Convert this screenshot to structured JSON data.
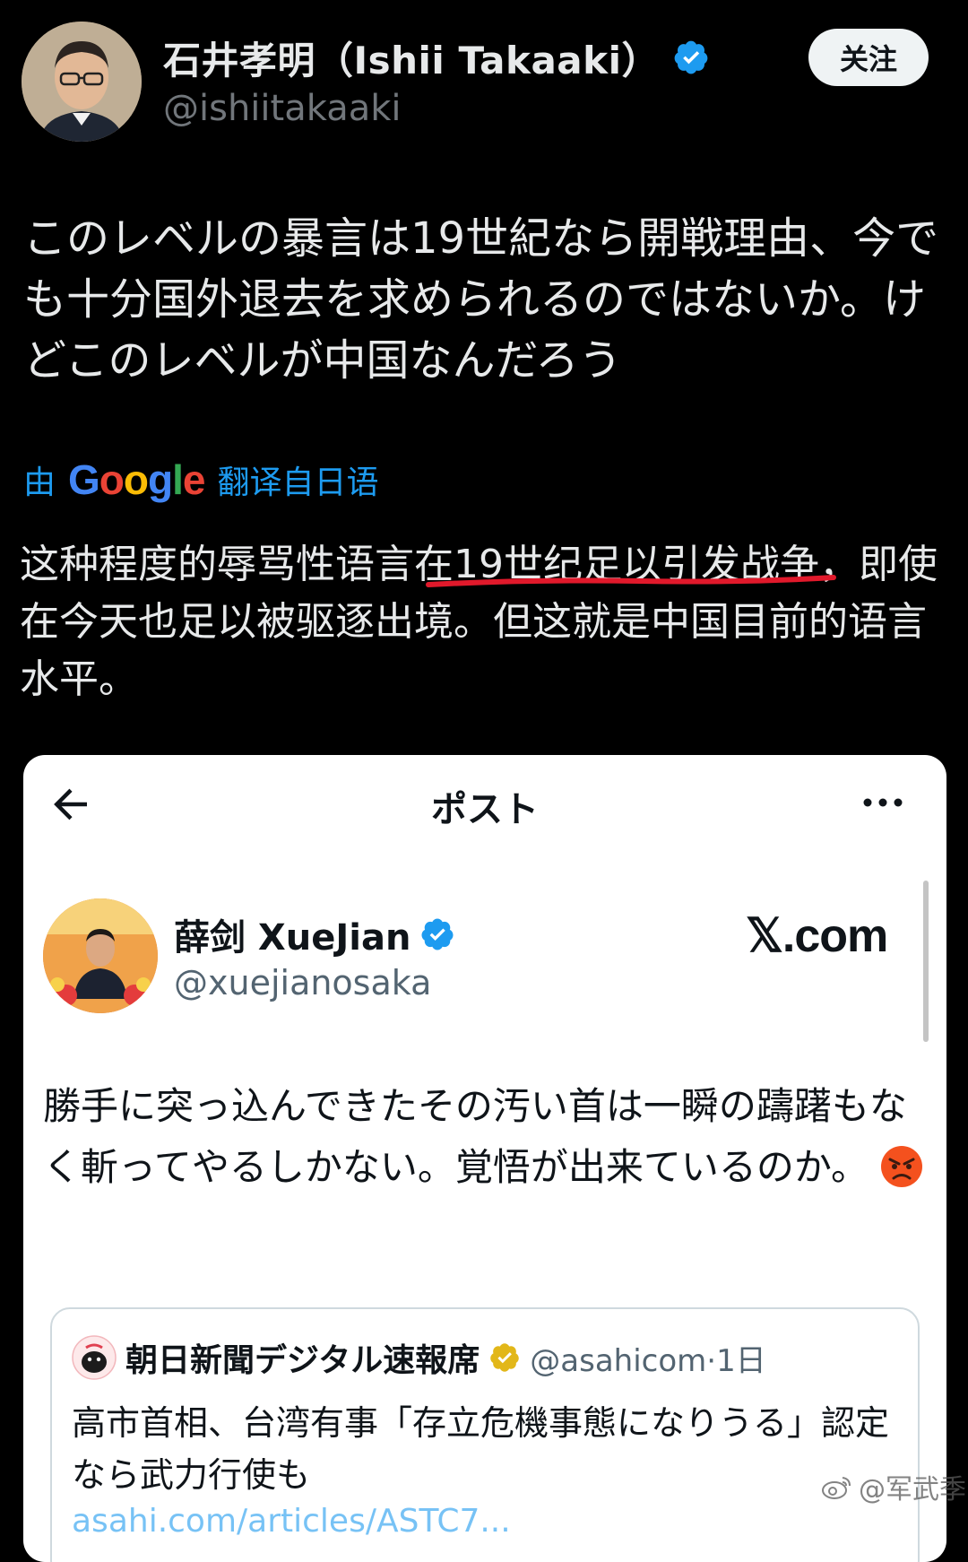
{
  "author": {
    "name": "石井孝明（Ishii Takaaki）",
    "handle": "@ishiitakaaki",
    "follow_label": "关注",
    "verified_color": "#1d9bf0"
  },
  "tweet": {
    "text_ja": "このレベルの暴言は19世紀なら開戦理由、今でも十分国外退去を求められるのではないか。けどこのレベルが中国なんだろう",
    "translate_prefix": "由",
    "translate_google": "Google",
    "translate_suffix": "翻译自日语",
    "text_zh": "这种程度的辱骂性语言在19世纪足以引发战争，即使在今天也足以被驱逐出境。但这就是中国目前的语言水平。"
  },
  "embedded_post": {
    "title": "ポスト",
    "author_name": "薛剑 XueJian",
    "author_handle": "@xuejianosaka",
    "source_logo": "𝕏.com",
    "text": "勝手に突っ込んできたその汚い首は一瞬の躊躇もなく斬ってやるしかない。覚悟が出来ているのか。",
    "emoji": "angry-face",
    "quote": {
      "name": "朝日新聞デジタル速報席",
      "handle_time": "@asahicom·1日",
      "text": "高市首相、台湾有事「存立危機事態になりうる」認定なら武力行使も",
      "link": "asahi.com/articles/ASTC7..."
    }
  },
  "watermark": {
    "text": "@军武季"
  },
  "colors": {
    "background": "#000000",
    "card_background": "#ffffff",
    "link_blue": "#1d9bf0",
    "underline_red": "#e0192b"
  }
}
